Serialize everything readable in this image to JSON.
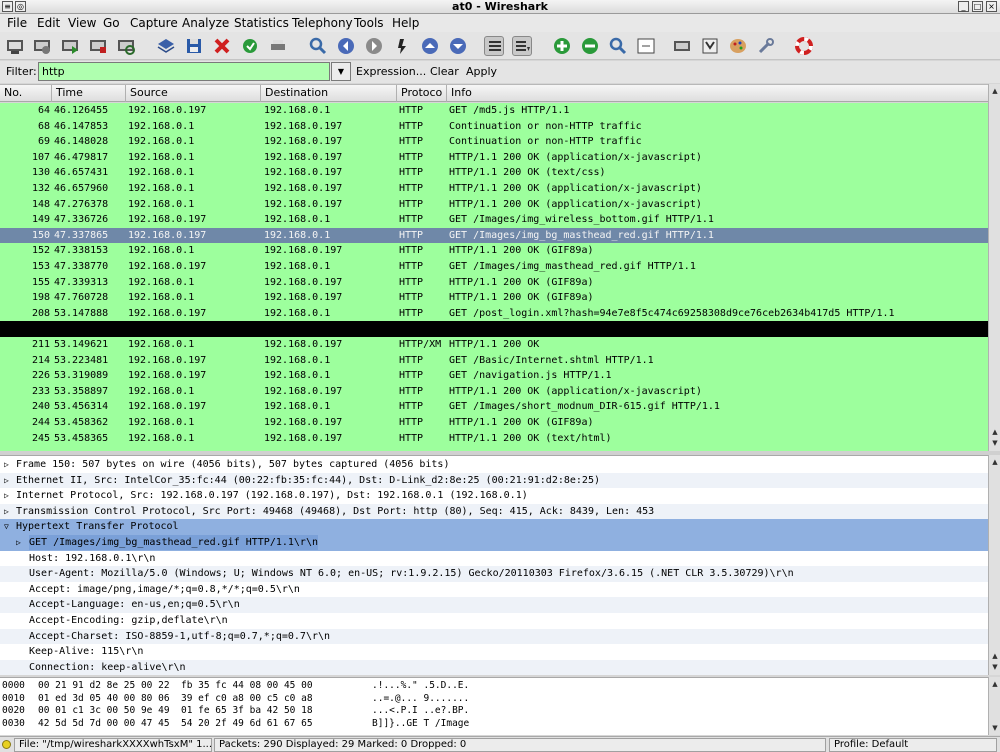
{
  "window": {
    "title": "at0 - Wireshark"
  },
  "menu": [
    "File",
    "Edit",
    "View",
    "Go",
    "Capture",
    "Analyze",
    "Statistics",
    "Telephony",
    "Tools",
    "Help"
  ],
  "toolbar": {
    "icons": [
      "interface-list-icon",
      "capture-options-icon",
      "start-capture-icon",
      "stop-capture-icon",
      "restart-capture-icon",
      "open-file-icon",
      "save-file-icon",
      "close-file-icon",
      "reload-icon",
      "print-icon",
      "find-packet-icon",
      "go-back-icon",
      "go-forward-icon",
      "go-to-packet-icon",
      "go-first-icon",
      "go-last-icon",
      "colorize-icon",
      "autoscroll-icon",
      "zoom-in-icon",
      "zoom-out-icon",
      "normal-size-icon",
      "resize-columns-icon",
      "capture-filters-icon",
      "display-filters-icon",
      "coloring-rules-icon",
      "preferences-icon",
      "help-icon"
    ]
  },
  "filter": {
    "label": "Filter:",
    "value": "http",
    "expression": "Expression...",
    "clear": "Clear",
    "apply": "Apply",
    "valid_color": "#afffaf"
  },
  "columns": [
    "No.",
    "Time",
    "Source",
    "Destination",
    "Protoco",
    "Info"
  ],
  "packets": [
    {
      "no": "64",
      "time": "46.126455",
      "src": "192.168.0.197",
      "dst": "192.168.0.1",
      "proto": "HTTP",
      "info": "GET /md5.js HTTP/1.1"
    },
    {
      "no": "68",
      "time": "46.147853",
      "src": "192.168.0.1",
      "dst": "192.168.0.197",
      "proto": "HTTP",
      "info": "Continuation or non-HTTP traffic"
    },
    {
      "no": "69",
      "time": "46.148028",
      "src": "192.168.0.1",
      "dst": "192.168.0.197",
      "proto": "HTTP",
      "info": "Continuation or non-HTTP traffic"
    },
    {
      "no": "107",
      "time": "46.479817",
      "src": "192.168.0.1",
      "dst": "192.168.0.197",
      "proto": "HTTP",
      "info": "HTTP/1.1 200 OK  (application/x-javascript)"
    },
    {
      "no": "130",
      "time": "46.657431",
      "src": "192.168.0.1",
      "dst": "192.168.0.197",
      "proto": "HTTP",
      "info": "HTTP/1.1 200 OK  (text/css)"
    },
    {
      "no": "132",
      "time": "46.657960",
      "src": "192.168.0.1",
      "dst": "192.168.0.197",
      "proto": "HTTP",
      "info": "HTTP/1.1 200 OK  (application/x-javascript)"
    },
    {
      "no": "148",
      "time": "47.276378",
      "src": "192.168.0.1",
      "dst": "192.168.0.197",
      "proto": "HTTP",
      "info": "HTTP/1.1 200 OK  (application/x-javascript)"
    },
    {
      "no": "149",
      "time": "47.336726",
      "src": "192.168.0.197",
      "dst": "192.168.0.1",
      "proto": "HTTP",
      "info": "GET /Images/img_wireless_bottom.gif HTTP/1.1"
    },
    {
      "no": "150",
      "time": "47.337865",
      "src": "192.168.0.197",
      "dst": "192.168.0.1",
      "proto": "HTTP",
      "info": "GET /Images/img_bg_masthead_red.gif HTTP/1.1",
      "selected": true
    },
    {
      "no": "152",
      "time": "47.338153",
      "src": "192.168.0.1",
      "dst": "192.168.0.197",
      "proto": "HTTP",
      "info": "HTTP/1.1 200 OK  (GIF89a)"
    },
    {
      "no": "153",
      "time": "47.338770",
      "src": "192.168.0.197",
      "dst": "192.168.0.1",
      "proto": "HTTP",
      "info": "GET /Images/img_masthead_red.gif HTTP/1.1"
    },
    {
      "no": "155",
      "time": "47.339313",
      "src": "192.168.0.1",
      "dst": "192.168.0.197",
      "proto": "HTTP",
      "info": "HTTP/1.1 200 OK  (GIF89a)"
    },
    {
      "no": "198",
      "time": "47.760728",
      "src": "192.168.0.1",
      "dst": "192.168.0.197",
      "proto": "HTTP",
      "info": "HTTP/1.1 200 OK  (GIF89a)"
    },
    {
      "no": "208",
      "time": "53.147888",
      "src": "192.168.0.197",
      "dst": "192.168.0.1",
      "proto": "HTTP",
      "info": "GET /post_login.xml?hash=94e7e8f5c474c69258308d9ce76ceb2634b417d5 HTTP/1.1"
    },
    {
      "black": true
    },
    {
      "no": "211",
      "time": "53.149621",
      "src": "192.168.0.1",
      "dst": "192.168.0.197",
      "proto": "HTTP/XM",
      "info": "HTTP/1.1 200 OK"
    },
    {
      "no": "214",
      "time": "53.223481",
      "src": "192.168.0.197",
      "dst": "192.168.0.1",
      "proto": "HTTP",
      "info": "GET /Basic/Internet.shtml HTTP/1.1"
    },
    {
      "no": "226",
      "time": "53.319089",
      "src": "192.168.0.197",
      "dst": "192.168.0.1",
      "proto": "HTTP",
      "info": "GET /navigation.js HTTP/1.1"
    },
    {
      "no": "233",
      "time": "53.358897",
      "src": "192.168.0.1",
      "dst": "192.168.0.197",
      "proto": "HTTP",
      "info": "HTTP/1.1 200 OK  (application/x-javascript)"
    },
    {
      "no": "240",
      "time": "53.456314",
      "src": "192.168.0.197",
      "dst": "192.168.0.1",
      "proto": "HTTP",
      "info": "GET /Images/short_modnum_DIR-615.gif HTTP/1.1"
    },
    {
      "no": "244",
      "time": "53.458362",
      "src": "192.168.0.1",
      "dst": "192.168.0.197",
      "proto": "HTTP",
      "info": "HTTP/1.1 200 OK  (GIF89a)"
    },
    {
      "no": "245",
      "time": "53.458365",
      "src": "192.168.0.1",
      "dst": "192.168.0.197",
      "proto": "HTTP",
      "info": "HTTP/1.1 200 OK  (text/html)"
    }
  ],
  "details": [
    {
      "text": "Frame 150: 507 bytes on wire (4056 bits), 507 bytes captured (4056 bits)",
      "tri": "▷",
      "level": 0
    },
    {
      "text": "Ethernet II, Src: IntelCor_35:fc:44 (00:22:fb:35:fc:44), Dst: D-Link_d2:8e:25 (00:21:91:d2:8e:25)",
      "tri": "▷",
      "level": 0
    },
    {
      "text": "Internet Protocol, Src: 192.168.0.197 (192.168.0.197), Dst: 192.168.0.1 (192.168.0.1)",
      "tri": "▷",
      "level": 0
    },
    {
      "text": "Transmission Control Protocol, Src Port: 49468 (49468), Dst Port: http (80), Seq: 415, Ack: 8439, Len: 453",
      "tri": "▷",
      "level": 0
    },
    {
      "text": "Hypertext Transfer Protocol",
      "tri": "▽",
      "level": 0,
      "hdr": true
    },
    {
      "text": "GET /Images/img_bg_masthead_red.gif HTTP/1.1\\r\\n",
      "tri": "▷",
      "level": 1,
      "sel": true
    },
    {
      "text": "Host: 192.168.0.1\\r\\n",
      "tri": "",
      "level": 1
    },
    {
      "text": "User-Agent: Mozilla/5.0 (Windows; U; Windows NT 6.0; en-US; rv:1.9.2.15) Gecko/20110303 Firefox/3.6.15 (.NET CLR 3.5.30729)\\r\\n",
      "tri": "",
      "level": 1
    },
    {
      "text": "Accept: image/png,image/*;q=0.8,*/*;q=0.5\\r\\n",
      "tri": "",
      "level": 1
    },
    {
      "text": "Accept-Language: en-us,en;q=0.5\\r\\n",
      "tri": "",
      "level": 1
    },
    {
      "text": "Accept-Encoding: gzip,deflate\\r\\n",
      "tri": "",
      "level": 1
    },
    {
      "text": "Accept-Charset: ISO-8859-1,utf-8;q=0.7,*;q=0.7\\r\\n",
      "tri": "",
      "level": 1
    },
    {
      "text": "Keep-Alive: 115\\r\\n",
      "tri": "",
      "level": 1
    },
    {
      "text": "Connection: keep-alive\\r\\n",
      "tri": "",
      "level": 1
    }
  ],
  "hex": [
    {
      "off": "0000",
      "bytes": "00 21 91 d2 8e 25 00 22  fb 35 fc 44 08 00 45 00",
      "ascii": ".!...%.\" .5.D..E."
    },
    {
      "off": "0010",
      "bytes": "01 ed 3d 05 40 00 80 06  39 ef c0 a8 00 c5 c0 a8",
      "ascii": "..=.@... 9......."
    },
    {
      "off": "0020",
      "bytes": "00 01 c1 3c 00 50 9e 49  01 fe 65 3f ba 42 50 18",
      "ascii": "...<.P.I ..e?.BP."
    },
    {
      "off": "0030",
      "bytes": "42 5d 5d 7d 00 00 47 45  54 20 2f 49 6d 61 67 65",
      "ascii": "B]]}..GE T /Image"
    }
  ],
  "status": {
    "file": "File: \"/tmp/wiresharkXXXXwhTsxM\" 1...",
    "packets": "Packets: 290 Displayed: 29 Marked: 0 Dropped: 0",
    "profile": "Profile: Default"
  }
}
